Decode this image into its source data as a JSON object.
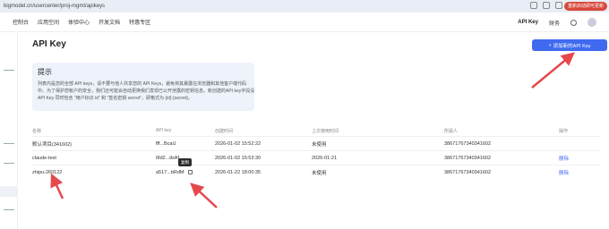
{
  "browser": {
    "url": "bigmodel.cn/usercenter/proj-mgmt/apikeys",
    "reload_label": "重新启动即可更新"
  },
  "topnav": {
    "items": [
      "控制台",
      "应用空间",
      "体验中心",
      "开发文档",
      "特惠专区"
    ],
    "right": {
      "api_key": "API Key",
      "finance": "财务"
    }
  },
  "page": {
    "title": "API Key",
    "create_button": "添加新的API Key"
  },
  "tip": {
    "title": "提示",
    "lines": [
      "列表内是您的全部 API keys，请不要与他人共享您的 API Keys，避免将其暴露在浏览器和其他客户端代码",
      "中。为了保护您帐户的安全，我们还可能会自动更换我们发现已公开泄露的密钥信息。新创建的API key字段没",
      "API Key 同时包含 \"用户标识 id\" 和 \"签名密钥 secret\"，即格式为 {id}.{secret}。"
    ]
  },
  "table": {
    "headers": [
      "名称",
      "API key",
      "创建时间",
      "上次使用时间",
      "所属人",
      "操作"
    ],
    "rows": [
      {
        "name": "默认项目(341602)",
        "key": "fff...BcaU",
        "created": "2026-01-02 15:52:22",
        "last_used": "未使用",
        "owner": "38671767340341602",
        "action": ""
      },
      {
        "name": "claude-test",
        "key": "6fd2...tlxAf",
        "created": "2026-01-02 15:53:30",
        "last_used": "2026-01-21",
        "owner": "38671767340341602",
        "action": "删除"
      },
      {
        "name": "zhipu-260122",
        "key": "a517...bRdM",
        "created": "2026-01-22 18:00:35",
        "last_used": "未使用",
        "owner": "38671767340341602",
        "action": "删除"
      }
    ]
  },
  "tooltip": "复制",
  "colors": {
    "accent": "#3f6af0",
    "arrow": "#e5484d",
    "tip_bg": "#eef2fb"
  }
}
